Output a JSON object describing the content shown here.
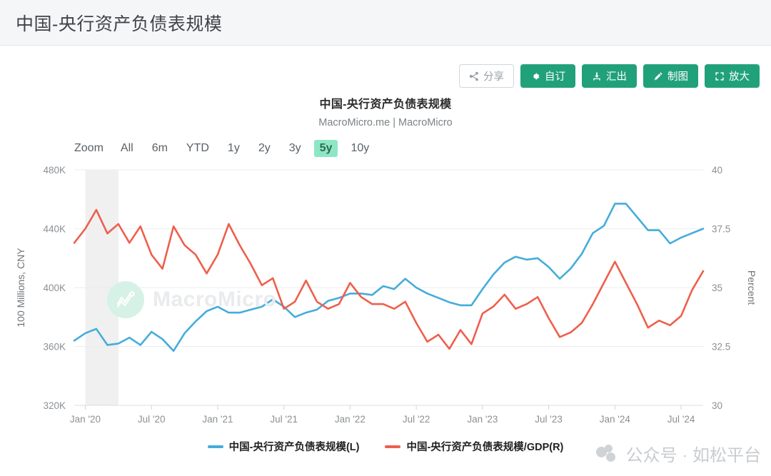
{
  "header": {
    "title": "中国-央行资产负债表规模"
  },
  "toolbar": {
    "buttons": [
      {
        "label": "分享",
        "icon": "share-icon",
        "style": "ghost"
      },
      {
        "label": "自订",
        "icon": "gear-icon",
        "style": "primary"
      },
      {
        "label": "汇出",
        "icon": "download-icon",
        "style": "primary"
      },
      {
        "label": "制图",
        "icon": "pencil-icon",
        "style": "primary"
      },
      {
        "label": "放大",
        "icon": "fullscreen-icon",
        "style": "primary"
      }
    ]
  },
  "chart": {
    "title": "中国-央行资产负债表规模",
    "subtitle": "MacroMicro.me | MacroMicro",
    "zoom_label": "Zoom",
    "ranges": [
      {
        "label": "All",
        "active": false
      },
      {
        "label": "6m",
        "active": false
      },
      {
        "label": "YTD",
        "active": false
      },
      {
        "label": "1y",
        "active": false
      },
      {
        "label": "2y",
        "active": false
      },
      {
        "label": "3y",
        "active": false
      },
      {
        "label": "5y",
        "active": true
      },
      {
        "label": "10y",
        "active": false
      }
    ],
    "watermark_brand": "MacroMicro",
    "watermark_corner": "公众号 · 如松平台",
    "colors": {
      "series_left": "#45ACDB",
      "series_right": "#EE5F4C",
      "highlight": "#8ee7c4",
      "accent": "#21a179"
    }
  },
  "chart_data": {
    "type": "line",
    "title": "中国-央行资产负债表规模",
    "subtitle": "MacroMicro.me | MacroMicro",
    "xlabel": "",
    "ylabel": "100 Millions, CNY",
    "y2label": "Percent",
    "ylim": [
      320000,
      480000
    ],
    "y2lim": [
      30,
      40
    ],
    "yticks": [
      320000,
      360000,
      400000,
      440000,
      480000
    ],
    "yticklabels": [
      "320K",
      "360K",
      "400K",
      "440K",
      "480K"
    ],
    "y2ticks": [
      30,
      32.5,
      35,
      37.5,
      40
    ],
    "y2ticklabels": [
      "30",
      "32.5",
      "35",
      "37.5",
      "40"
    ],
    "grid": true,
    "legend_position": "bottom",
    "xticklabels": [
      "Jan '20",
      "Jul '20",
      "Jan '21",
      "Jul '21",
      "Jan '22",
      "Jul '22",
      "Jan '23",
      "Jul '23",
      "Jan '24",
      "Jul '24"
    ],
    "x": [
      "2019-12",
      "2020-01",
      "2020-02",
      "2020-03",
      "2020-04",
      "2020-05",
      "2020-06",
      "2020-07",
      "2020-08",
      "2020-09",
      "2020-10",
      "2020-11",
      "2020-12",
      "2021-01",
      "2021-02",
      "2021-03",
      "2021-04",
      "2021-05",
      "2021-06",
      "2021-07",
      "2021-08",
      "2021-09",
      "2021-10",
      "2021-11",
      "2021-12",
      "2022-01",
      "2022-02",
      "2022-03",
      "2022-04",
      "2022-05",
      "2022-06",
      "2022-07",
      "2022-08",
      "2022-09",
      "2022-10",
      "2022-11",
      "2022-12",
      "2023-01",
      "2023-02",
      "2023-03",
      "2023-04",
      "2023-05",
      "2023-06",
      "2023-07",
      "2023-08",
      "2023-09",
      "2023-10",
      "2023-11",
      "2023-12",
      "2024-01",
      "2024-02",
      "2024-03",
      "2024-04",
      "2024-05",
      "2024-06",
      "2024-07",
      "2024-08",
      "2024-09"
    ],
    "shaded_regions": [
      {
        "start": "2020-01",
        "end": "2020-04",
        "color": "#f0f0f0",
        "label": ""
      }
    ],
    "series": [
      {
        "name": "中国-央行资产负债表规模(L)",
        "axis": "left",
        "color": "#45ACDB",
        "unit": "100 Millions, CNY",
        "values": [
          364000,
          369000,
          372000,
          361000,
          362000,
          366000,
          361000,
          370000,
          365000,
          357000,
          369000,
          377000,
          384000,
          387000,
          383000,
          383000,
          385000,
          387000,
          392000,
          387000,
          380000,
          383000,
          385000,
          391000,
          393000,
          396000,
          396000,
          395000,
          401000,
          399000,
          406000,
          400000,
          396000,
          393000,
          390000,
          388000,
          388000,
          399000,
          409000,
          417000,
          421000,
          419000,
          420000,
          414000,
          406000,
          413000,
          423000,
          437000,
          442000,
          457000,
          457000,
          448000,
          439000,
          439000,
          430000,
          434000,
          437000,
          440000
        ]
      },
      {
        "name": "中国-央行资产负债表规模/GDP(R)",
        "axis": "right",
        "color": "#EE5F4C",
        "unit": "Percent",
        "values": [
          36.9,
          37.5,
          38.3,
          37.3,
          37.7,
          36.9,
          37.6,
          36.4,
          35.8,
          37.6,
          36.8,
          36.4,
          35.6,
          36.4,
          37.7,
          36.8,
          36.0,
          35.1,
          35.4,
          34.1,
          34.4,
          35.3,
          34.4,
          34.1,
          34.3,
          35.2,
          34.6,
          34.3,
          34.3,
          34.1,
          34.4,
          33.5,
          32.7,
          33.0,
          32.4,
          33.2,
          32.6,
          33.9,
          34.2,
          34.7,
          34.1,
          34.3,
          34.6,
          33.7,
          32.9,
          33.1,
          33.5,
          34.3,
          35.2,
          36.1,
          35.2,
          34.3,
          33.3,
          33.6,
          33.4,
          33.8,
          34.9,
          35.7
        ]
      }
    ]
  }
}
